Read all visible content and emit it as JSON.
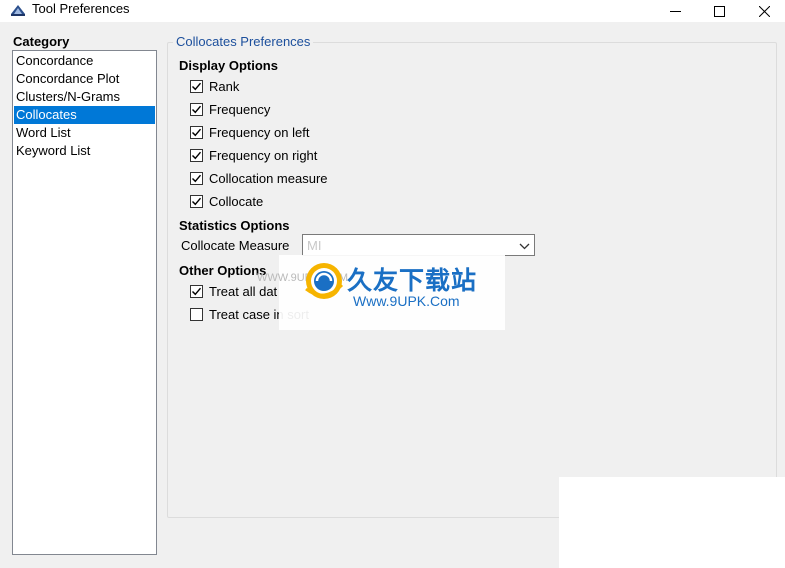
{
  "window": {
    "title": "Tool Preferences",
    "minimize_glyph": "—",
    "maximize_glyph": "☐",
    "close_glyph": "✕"
  },
  "category": {
    "label": "Category",
    "items": [
      {
        "label": "Concordance",
        "selected": false
      },
      {
        "label": "Concordance Plot",
        "selected": false
      },
      {
        "label": "Clusters/N-Grams",
        "selected": false
      },
      {
        "label": "Collocates",
        "selected": true
      },
      {
        "label": "Word List",
        "selected": false
      },
      {
        "label": "Keyword List",
        "selected": false
      }
    ]
  },
  "preferences": {
    "title": "Collocates Preferences",
    "display_options": {
      "title": "Display Options",
      "items": [
        {
          "label": "Rank",
          "checked": true
        },
        {
          "label": "Frequency",
          "checked": true
        },
        {
          "label": "Frequency on left",
          "checked": true
        },
        {
          "label": "Frequency on right",
          "checked": true
        },
        {
          "label": "Collocation measure",
          "checked": true
        },
        {
          "label": "Collocate",
          "checked": true
        }
      ]
    },
    "statistics_options": {
      "title": "Statistics Options",
      "measure_label": "Collocate Measure",
      "measure_value": "MI"
    },
    "other_options": {
      "title": "Other Options",
      "items": [
        {
          "label": "Treat all dat",
          "checked": true
        },
        {
          "label": "Treat case in sort",
          "checked": false
        }
      ]
    }
  },
  "watermark": {
    "brand_cn": "久友下载站",
    "url": "Www.9UPK.Com",
    "url_small": "WWW.9UPK.COM"
  },
  "colors": {
    "selection": "#0078d7",
    "group_title": "#1c4f9c",
    "watermark": "#1a6fc4"
  }
}
